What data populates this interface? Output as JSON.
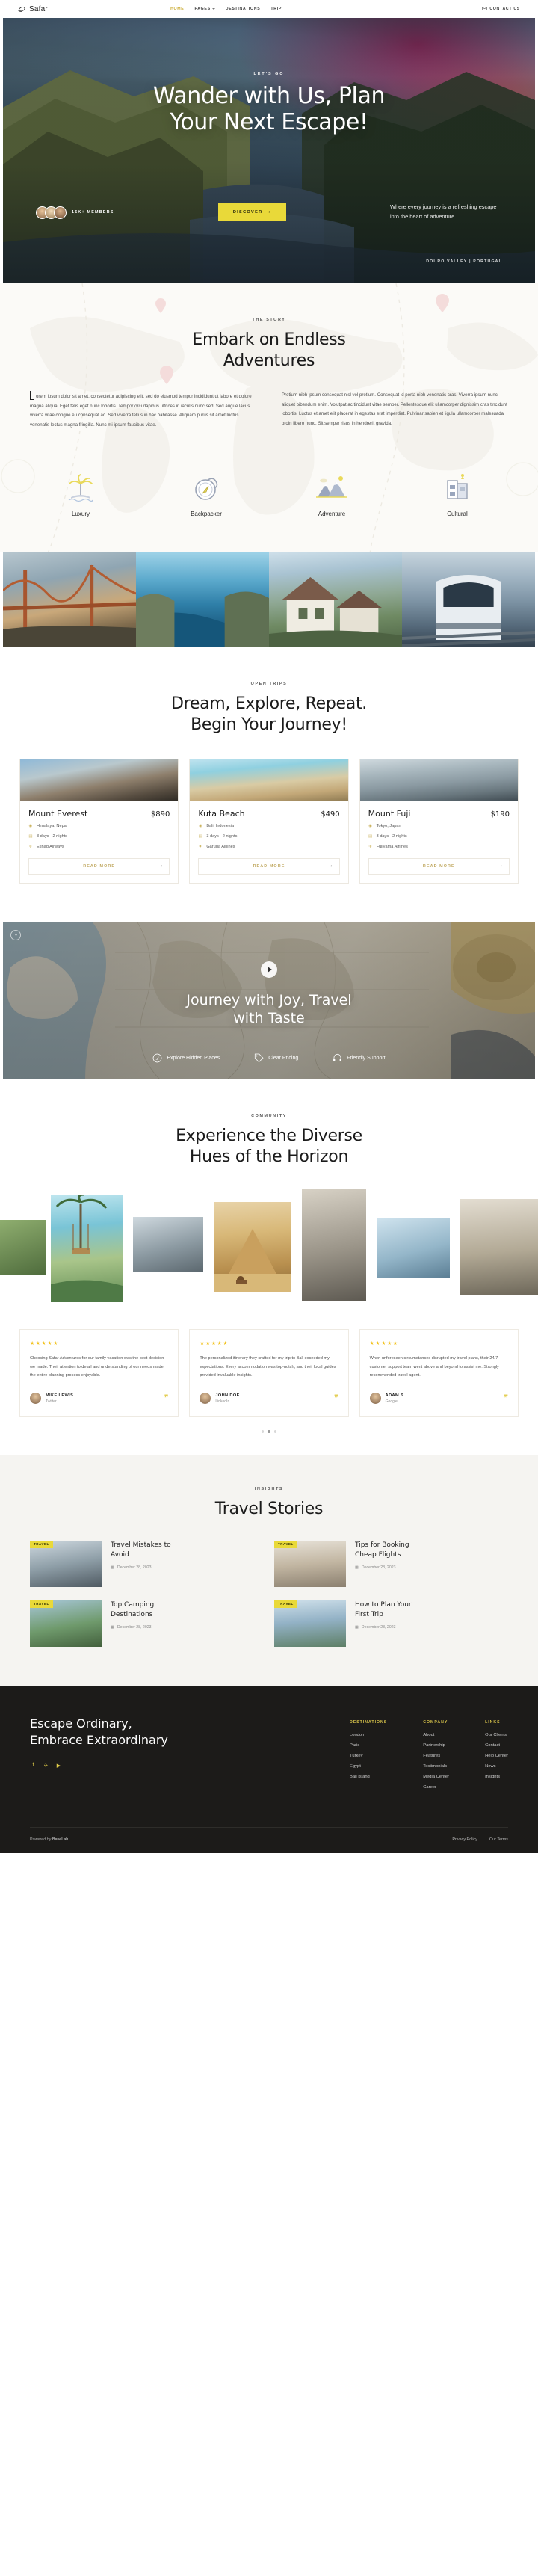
{
  "header": {
    "brand": "Safar",
    "brand_icon": "hat-icon",
    "nav": [
      {
        "label": "HOME",
        "active": true
      },
      {
        "label": "PAGES",
        "active": false,
        "caret": true
      },
      {
        "label": "DESTINATIONS",
        "active": false
      },
      {
        "label": "TRIP",
        "active": false
      }
    ],
    "contact_label": "CONTACT US",
    "contact_icon": "envelope-icon"
  },
  "hero": {
    "eyebrow": "LET'S GO",
    "title_line1": "Wander with Us, Plan",
    "title_line2": "Your Next Escape!",
    "members_count": "15K+ MEMBERS",
    "discover_label": "DISCOVER",
    "subtitle": "Where every journey is a refreshing escape into the heart of adventure.",
    "location": "DOURO VALLEY | PORTUGAL"
  },
  "story": {
    "eyebrow": "THE STORY",
    "title_line1": "Embark on Endless",
    "title_line2": "Adventures",
    "col1": "orem ipsum dolor sit amet, consectetur adipiscing elit, sed do eiusmod tempor incididunt ut labore et dolore magna aliqua. Eget felis eget nunc lobortis. Tempor orci dapibus ultrices in iaculis nunc sed. Sed augue lacus viverra vitae congue eu consequat ac. Sed viverra tellus in hac habitasse. Aliquam purus sit amet luctus venenatis lectus magna fringilla. Nunc mi ipsum faucibus vitae.",
    "col2": "Pretium nibh ipsum consequat nisl vel pretium. Consequat id porta nibh venenatis cras. Viverra ipsum nunc aliquet bibendum enim. Volutpat ac tincidunt vitae semper. Pellentesque elit ullamcorper dignissim cras tincidunt lobortis. Luctus et amet elit placerat in egestas erat imperdiet. Pulvinar sapien et ligula ullamcorper malesuada proin libero nunc. Sit semper risus in hendrerit gravida.",
    "features": [
      {
        "label": "Luxury",
        "icon": "palm-island-icon"
      },
      {
        "label": "Backpacker",
        "icon": "compass-icon"
      },
      {
        "label": "Adventure",
        "icon": "mountains-icon"
      },
      {
        "label": "Cultural",
        "icon": "temple-icon"
      }
    ]
  },
  "gallery": [
    {
      "name": "golden-gate-bridge-photo"
    },
    {
      "name": "ocean-cliff-photo"
    },
    {
      "name": "village-houses-photo"
    },
    {
      "name": "tram-train-photo"
    }
  ],
  "trips": {
    "eyebrow": "OPEN TRIPS",
    "title_line1": "Dream, Explore, Repeat.",
    "title_line2": "Begin Your Journey!",
    "read_more": "READ MORE",
    "cards": [
      {
        "title": "Mount Everest",
        "price": "$890",
        "location": "Himalaya, Nepal",
        "duration": "3 days · 2 nights",
        "airline": "Etihad Airways"
      },
      {
        "title": "Kuta Beach",
        "price": "$490",
        "location": "Bali, Indonesia",
        "duration": "3 days · 2 nights",
        "airline": "Garuda Airlines"
      },
      {
        "title": "Mount Fuji",
        "price": "$190",
        "location": "Tokyo, Japan",
        "duration": "3 days · 2 nights",
        "airline": "Fujiyama Airlines"
      }
    ]
  },
  "cta": {
    "title_line1": "Journey with Joy, Travel",
    "title_line2": "with Taste",
    "features": [
      {
        "label": "Explore Hidden Places",
        "icon": "compass-outline-icon"
      },
      {
        "label": "Clear Pricing",
        "icon": "tag-icon"
      },
      {
        "label": "Friendly Support",
        "icon": "support-icon"
      }
    ]
  },
  "community": {
    "eyebrow": "COMMUNITY",
    "title_line1": "Experience the Diverse",
    "title_line2": "Hues of the Horizon"
  },
  "testimonials": [
    {
      "rating": "★★★★★",
      "text": "Choosing Safar Adventures for our family vacation was the best decision we made. Their attention to detail and understanding of our needs made the entire planning process enjoyable.",
      "name": "MIKE LEWIS",
      "source": "Twitter"
    },
    {
      "rating": "★★★★★",
      "text": "The personalized itinerary they crafted for my trip to Bali exceeded my expectations. Every accommodation was top-notch, and their local guides provided invaluable insights.",
      "name": "JOHN DOE",
      "source": "LinkedIn"
    },
    {
      "rating": "★★★★★",
      "text": "When unforeseen circumstances disrupted my travel plans, their 24/7 customer support team went above and beyond to assist me. Strongly recommended travel agent.",
      "name": "ADAM S",
      "source": "Google"
    }
  ],
  "blog": {
    "eyebrow": "INSIGHTS",
    "title": "Travel Stories",
    "posts": [
      {
        "tag": "TRAVEL",
        "title_line1": "Travel Mistakes to",
        "title_line2": "Avoid",
        "date": "December 28, 2023"
      },
      {
        "tag": "TRAVEL",
        "title_line1": "Tips for Booking",
        "title_line2": "Cheap Flights",
        "date": "December 28, 2023"
      },
      {
        "tag": "TRAVEL",
        "title_line1": "Top Camping",
        "title_line2": "Destinations",
        "date": "December 28, 2023"
      },
      {
        "tag": "TRAVEL",
        "title_line1": "How to Plan Your",
        "title_line2": "First Trip",
        "date": "December 28, 2023"
      }
    ]
  },
  "footer": {
    "heading_line1": "Escape Ordinary,",
    "heading_line2": "Embrace Extraordinary",
    "socials": [
      {
        "icon": "facebook-icon",
        "glyph": "f"
      },
      {
        "icon": "twitter-icon",
        "glyph": "✈"
      },
      {
        "icon": "youtube-icon",
        "glyph": "▶"
      }
    ],
    "columns": [
      {
        "title": "DESTINATIONS",
        "links": [
          "London",
          "Paris",
          "Turkey",
          "Egypt",
          "Bali Island"
        ]
      },
      {
        "title": "COMPANY",
        "links": [
          "About",
          "Partnership",
          "Features",
          "Testimonials",
          "Media Center",
          "Career"
        ]
      },
      {
        "title": "LINKS",
        "links": [
          "Our Clients",
          "Contact",
          "Help Center",
          "News",
          "Insights"
        ]
      }
    ],
    "powered_prefix": "Powered by ",
    "powered_brand": "BaseLab",
    "bottom_links": [
      "Privacy Policy",
      "Our Terms"
    ]
  },
  "colors": {
    "accent_gold": "#c9a92c",
    "yellow": "#e9d939",
    "dark": "#1c1b19",
    "star": "#f2c21c"
  }
}
